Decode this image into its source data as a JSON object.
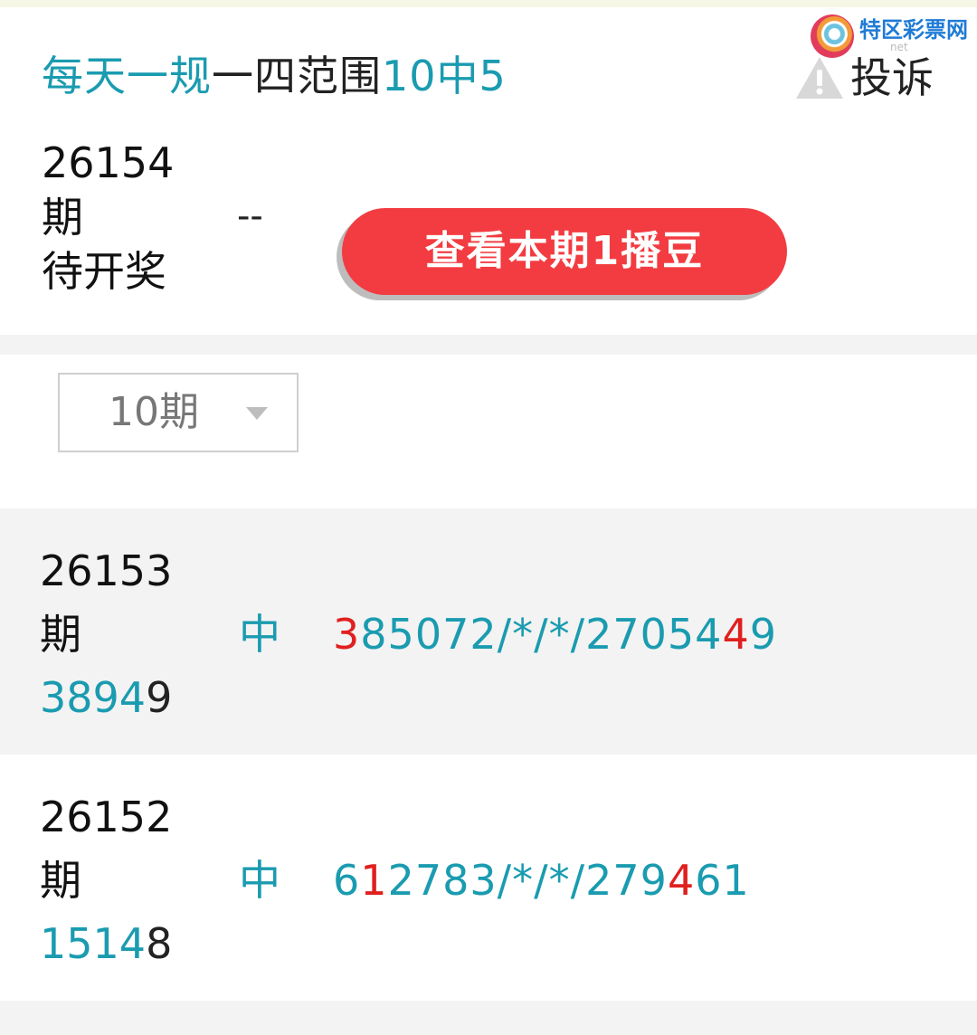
{
  "header": {
    "title_part1": "每天一规",
    "title_part2": "一四范围",
    "title_part3": "10中5",
    "complain_label": "投诉",
    "logo_text": "特区彩票网",
    "logo_sub": "net"
  },
  "current": {
    "number": "26154",
    "suffix": "期",
    "status": "待开奖",
    "dash": "--",
    "view_button": "查看本期1播豆"
  },
  "selector": {
    "value": "10期"
  },
  "rows": [
    {
      "number": "26153",
      "suffix": "期",
      "result_teal": "3894",
      "result_dark": "9",
      "hit": "中",
      "nums": [
        {
          "t": "3",
          "red": true
        },
        {
          "t": "85072/*/*/27054",
          "red": false
        },
        {
          "t": "4",
          "red": true
        },
        {
          "t": "9",
          "red": false
        }
      ]
    },
    {
      "number": "26152",
      "suffix": "期",
      "result_teal": "1514",
      "result_dark": "8",
      "hit": "中",
      "nums": [
        {
          "t": "6",
          "red": false
        },
        {
          "t": "1",
          "red": true
        },
        {
          "t": "2783/*/*/279",
          "red": false
        },
        {
          "t": "4",
          "red": true
        },
        {
          "t": "61",
          "red": false
        }
      ]
    }
  ],
  "colors": {
    "teal": "#1a9bb0",
    "red": "#e0201f",
    "button": "#f23c41"
  }
}
